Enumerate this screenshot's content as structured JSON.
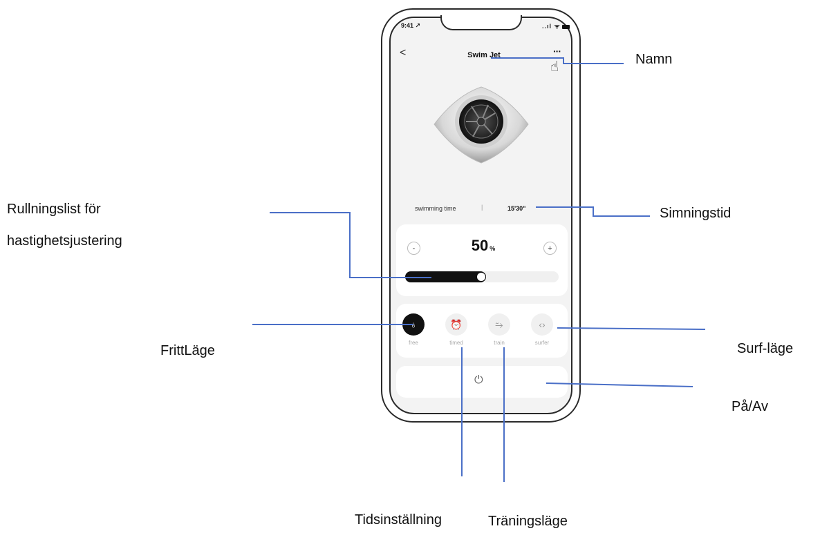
{
  "status_bar": {
    "time": "9:41 ↗",
    "icons": "..ıl ᯤ"
  },
  "nav": {
    "back": "<",
    "title": "Swim Jet",
    "more": "···"
  },
  "swimming": {
    "label": "swimming time",
    "separator": "|",
    "value": "15'30\""
  },
  "speed": {
    "minus": "-",
    "plus": "+",
    "value": "50",
    "unit": "%",
    "level": 0.5
  },
  "modes": [
    {
      "label": "free",
      "icon": "drop-icon",
      "glyph": "♁",
      "active": true
    },
    {
      "label": "timed",
      "icon": "alarm-clock-icon",
      "glyph": "⏰",
      "active": false
    },
    {
      "label": "train",
      "icon": "wave-icon",
      "glyph": "⥲",
      "active": false
    },
    {
      "label": "surfer",
      "icon": "code-brackets-icon",
      "glyph": "‹›",
      "active": false
    }
  ],
  "power": {
    "icon": "power-icon",
    "glyph": "⏻"
  },
  "annotations": {
    "name": "Namn",
    "speed_slider_line1": "Rullningslist för",
    "speed_slider_line2": "hastighetsjustering",
    "swim_time": "Simningstid",
    "free_mode": "FrittLäge",
    "surf_mode": "Surf-läge",
    "power": "På/Av",
    "timer": "Tidsinställning",
    "training": "Träningsläge"
  },
  "colors": {
    "annotation_line": "#4a6fc7",
    "active_mode": "#111111",
    "screen_bg": "#f3f3f3"
  }
}
